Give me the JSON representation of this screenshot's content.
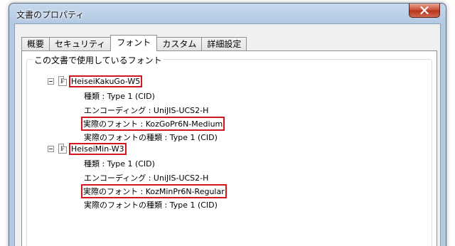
{
  "window": {
    "title": "文書のプロパティ"
  },
  "tabs": [
    {
      "label": "概要",
      "active": false
    },
    {
      "label": "セキュリティ",
      "active": false
    },
    {
      "label": "フォント",
      "active": true
    },
    {
      "label": "カスタム",
      "active": false
    },
    {
      "label": "詳細設定",
      "active": false
    }
  ],
  "fonts_group": {
    "title": "この文書で使用しているフォント",
    "fonts": [
      {
        "name": "HeiseiKakuGo-W5",
        "type": "種類 : Type 1 (CID)",
        "encoding": "エンコーディング : UniJIS-UCS2-H",
        "actual_font": "実際のフォント : KozGoPr6N-Medium",
        "actual_type": "実際のフォントの種類 : Type 1 (CID)"
      },
      {
        "name": "HeiseiMin-W3",
        "type": "種類 : Type 1 (CID)",
        "encoding": "エンコーディング : UniJIS-UCS2-H",
        "actual_font": "実際のフォント : KozMinPr6N-Regular",
        "actual_type": "実際のフォントの種類 : Type 1 (CID)"
      }
    ]
  },
  "icons": {
    "close": "close-icon",
    "expander": "collapse-icon",
    "font": "font-file-icon"
  },
  "colors": {
    "highlight": "#d1161e"
  }
}
